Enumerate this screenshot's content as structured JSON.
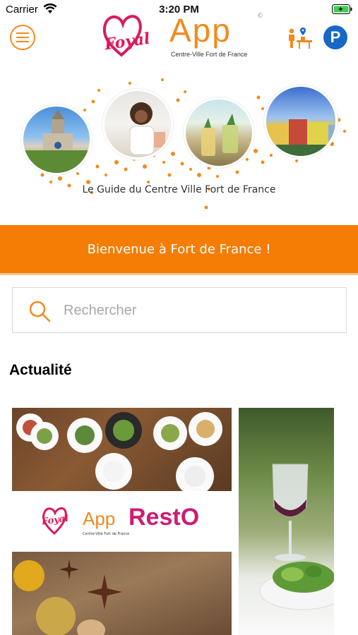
{
  "status_bar": {
    "carrier": "Carrier",
    "time": "3:20 PM"
  },
  "header": {
    "logo": {
      "script": "Foyal",
      "app": "App",
      "registered": "©",
      "subtitle": "Centre-Ville Fort de France"
    },
    "parking_label": "P"
  },
  "hero": {
    "caption": "Le Guide du Centre Ville Fort de France"
  },
  "banner": {
    "text": "Bienvenue à Fort de France !"
  },
  "search": {
    "placeholder": "Rechercher",
    "value": ""
  },
  "news": {
    "title": "Actualité",
    "cards": [
      {
        "logo_script": "Foyal",
        "logo_app": "App",
        "logo_sub": "Centre-Ville Fort de France",
        "logo_word": "RestO"
      },
      {}
    ]
  },
  "colors": {
    "accent": "#f57d05",
    "brand_pink": "#e3165b",
    "parking_blue": "#1668c7"
  },
  "icons": [
    "wifi-icon",
    "battery-icon",
    "menu-icon",
    "guide-map-icon",
    "parking-icon",
    "search-icon"
  ]
}
